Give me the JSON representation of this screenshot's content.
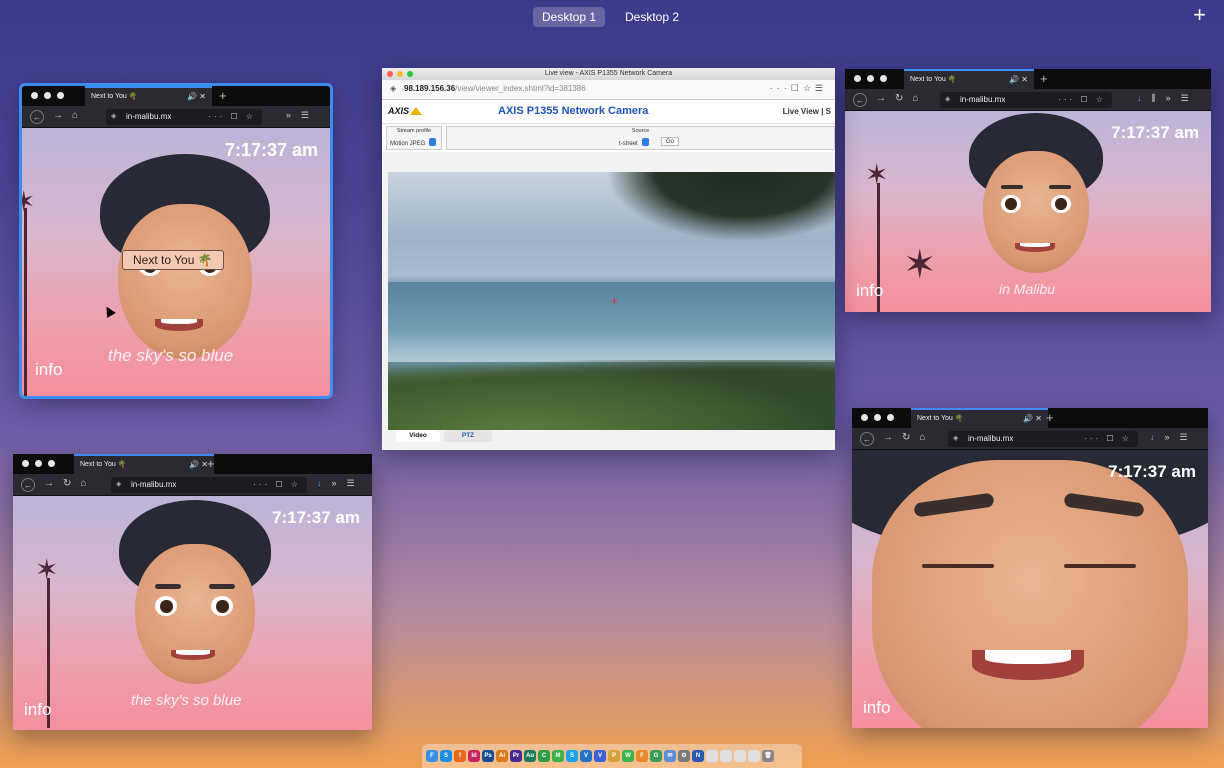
{
  "spaces": {
    "desktop1": "Desktop 1",
    "desktop2": "Desktop 2",
    "add_icon": "plus-icon"
  },
  "firefox": {
    "tab_title": "Next to You",
    "tab_emoji": "🌴",
    "tab_controls": "🔊 ✕",
    "new_tab": "+",
    "url": "in-malibu.mx",
    "url_actions": "··· ☐ ☆",
    "menu": "☰"
  },
  "page": {
    "time": "7:17:37 am",
    "info": "info",
    "caption_blue": "the sky's so blue",
    "caption_malibu": "in Malibu",
    "tooltip": "Next to You 🌴"
  },
  "camera": {
    "window_title": "Live view - AXIS P1355 Network Camera",
    "url_host": "98.189.156.36",
    "url_path": "/view/viewer_index.shtml?id=381386",
    "logo": "AXIS",
    "title": "AXIS P1355 Network Camera",
    "live_view": "Live View | S",
    "stream_profile_label": "Stream profile",
    "stream_profile_value": "Motion JPEG",
    "source_label": "Source",
    "source_value": "t-street",
    "go_label": "Go",
    "tab_video": "Video",
    "tab_ptz": "PTZ"
  },
  "dock_apps": [
    {
      "name": "finder",
      "glyph": "F",
      "color": "#3a8ee6"
    },
    {
      "name": "safari",
      "glyph": "S",
      "color": "#1d8fe6"
    },
    {
      "name": "firefox",
      "glyph": "f",
      "color": "#e66a1d"
    },
    {
      "name": "indesign",
      "glyph": "Id",
      "color": "#c7245b"
    },
    {
      "name": "photoshop",
      "glyph": "Ps",
      "color": "#1a4d8f"
    },
    {
      "name": "illustrator",
      "glyph": "Ai",
      "color": "#d77a1c"
    },
    {
      "name": "premiere",
      "glyph": "Pr",
      "color": "#4b2a8f"
    },
    {
      "name": "audition",
      "glyph": "Au",
      "color": "#1c7a5d"
    },
    {
      "name": "chrome",
      "glyph": "C",
      "color": "#2f9e4a"
    },
    {
      "name": "messages",
      "glyph": "M",
      "color": "#3bb34a"
    },
    {
      "name": "skype",
      "glyph": "S",
      "color": "#1aa2e6"
    },
    {
      "name": "vscode",
      "glyph": "V",
      "color": "#2473c4"
    },
    {
      "name": "vpn",
      "glyph": "V",
      "color": "#3b5fd6"
    },
    {
      "name": "photos",
      "glyph": "P",
      "color": "#d6a33b"
    },
    {
      "name": "wechat",
      "glyph": "W",
      "color": "#3bb34a"
    },
    {
      "name": "facetime",
      "glyph": "F",
      "color": "#e98a2a"
    },
    {
      "name": "git",
      "glyph": "G",
      "color": "#3a9e58"
    },
    {
      "name": "mail",
      "glyph": "✉",
      "color": "#5b8fd9"
    },
    {
      "name": "system-prefs",
      "glyph": "⚙",
      "color": "#7a7a7a"
    },
    {
      "name": "network",
      "glyph": "N",
      "color": "#2a5bb3"
    },
    {
      "name": "doc1",
      "glyph": "",
      "color": "#e0e0e0"
    },
    {
      "name": "doc2",
      "glyph": "",
      "color": "#e0e0e0"
    },
    {
      "name": "doc3",
      "glyph": "",
      "color": "#e0e0e0"
    },
    {
      "name": "doc4",
      "glyph": "",
      "color": "#e0e0e0"
    },
    {
      "name": "trash",
      "glyph": "🗑",
      "color": "#888888"
    }
  ]
}
